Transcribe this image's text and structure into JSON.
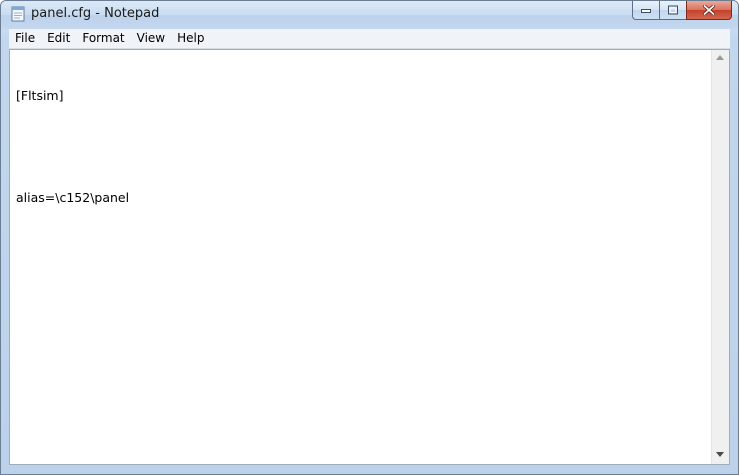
{
  "window": {
    "title": "panel.cfg - Notepad"
  },
  "menu": [
    "File",
    "Edit",
    "Format",
    "View",
    "Help"
  ],
  "editor": {
    "lines": [
      "[Fltsim]",
      "",
      "alias=\\c152\\panel"
    ]
  },
  "icons": {
    "app": "notepad-icon",
    "minimize": "minimize-icon",
    "maximize": "maximize-icon",
    "close": "close-icon",
    "scroll_up": "scroll-up-arrow-icon",
    "scroll_down": "scroll-down-arrow-icon"
  },
  "colors": {
    "title_bar": "#c9dcf1",
    "close_button": "#c5422a",
    "editor_background": "#ffffff"
  }
}
